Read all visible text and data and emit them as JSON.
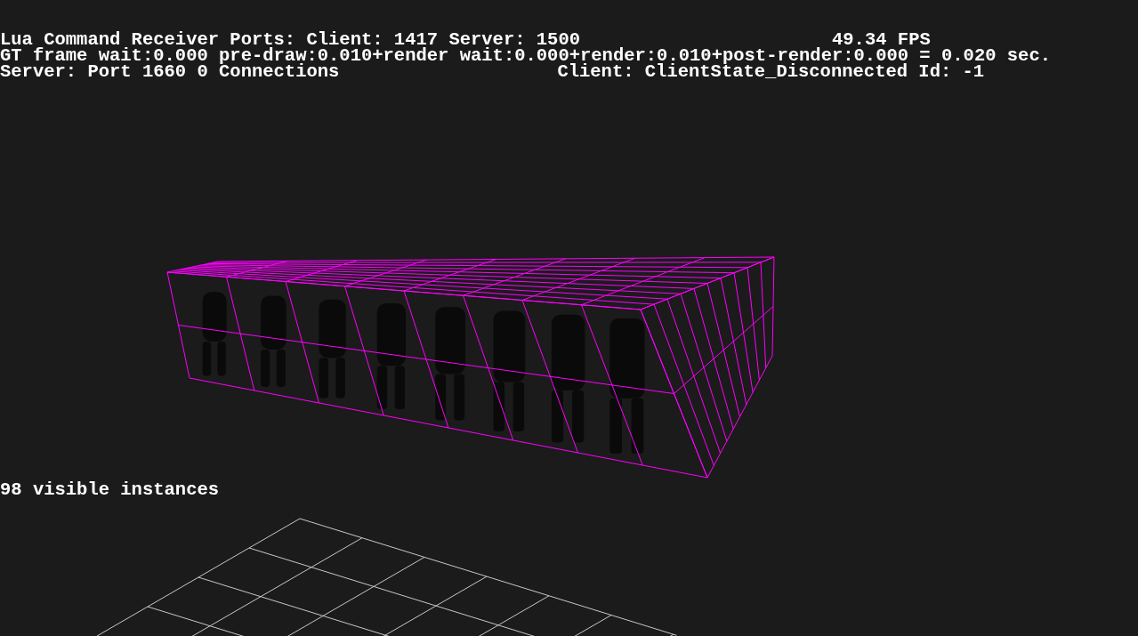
{
  "hud": {
    "lines": [
      {
        "left": "Lua Command Receiver Ports: Client: 1417 Server: 1500",
        "right": "49.34 FPS"
      },
      {
        "left": "GT frame wait:0.000 pre-draw:0.010+render wait:0.000+render:0.010+post-render:0.000 = 0.020 sec."
      },
      {
        "left": "Server: Port 1660 0 Connections",
        "right": "Client: ClientState_Disconnected Id: -1"
      }
    ]
  },
  "scene": {
    "caption": "98 visible instances"
  }
}
